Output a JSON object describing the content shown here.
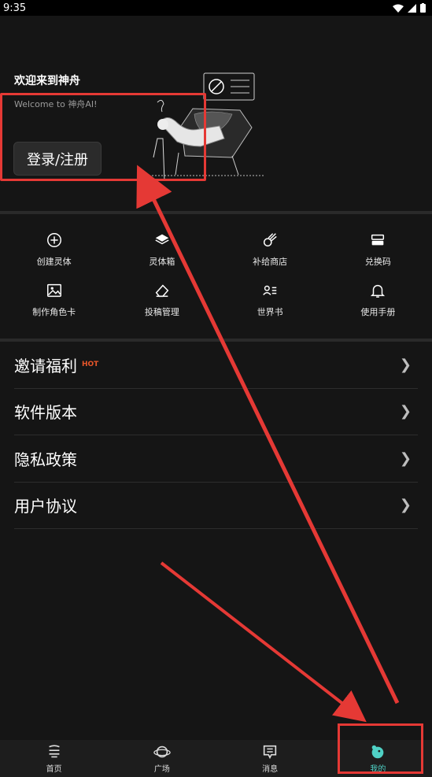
{
  "status_bar": {
    "time": "9:35"
  },
  "header": {
    "title": "欢迎来到神舟",
    "subtitle": "Welcome to 神舟AI!",
    "login_label": "登录/注册"
  },
  "quick_actions": [
    {
      "label": "创建灵体",
      "icon": "plus-circle-icon"
    },
    {
      "label": "灵体箱",
      "icon": "book-icon"
    },
    {
      "label": "补给商店",
      "icon": "meteor-icon"
    },
    {
      "label": "兑换码",
      "icon": "ticket-icon"
    },
    {
      "label": "制作角色卡",
      "icon": "image-icon"
    },
    {
      "label": "投稿管理",
      "icon": "eraser-icon"
    },
    {
      "label": "世界书",
      "icon": "user-list-icon"
    },
    {
      "label": "使用手册",
      "icon": "bell-icon"
    }
  ],
  "menu": [
    {
      "label": "邀请福利",
      "badge": "HOT"
    },
    {
      "label": "软件版本"
    },
    {
      "label": "隐私政策"
    },
    {
      "label": "用户协议"
    }
  ],
  "tabbar": [
    {
      "label": "首页",
      "icon": "home-icon"
    },
    {
      "label": "广场",
      "icon": "planet-icon"
    },
    {
      "label": "消息",
      "icon": "message-icon"
    },
    {
      "label": "我的",
      "icon": "profile-icon",
      "active": true
    }
  ],
  "colors": {
    "background": "#151515",
    "accent": "#4fd1c5",
    "annotation": "#e53935"
  }
}
